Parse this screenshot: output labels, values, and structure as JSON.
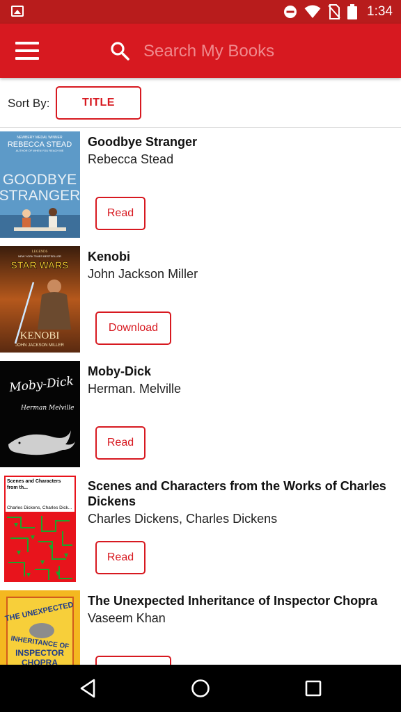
{
  "status_bar": {
    "time": "1:34",
    "icons": [
      "gallery-icon",
      "do-not-disturb-icon",
      "wifi-icon",
      "no-sim-icon",
      "battery-icon"
    ]
  },
  "app_bar": {
    "search_placeholder": "Search My Books",
    "icons": [
      "menu-icon",
      "search-icon"
    ]
  },
  "sort": {
    "label": "Sort By:",
    "value": "TITLE"
  },
  "books": [
    {
      "title": "Goodbye Stranger",
      "author": "Rebecca Stead",
      "action": "Read",
      "cover_text": [
        "NEWBERY MEDAL WINNER",
        "REBECCA STEAD",
        "AUTHOR OF WHEN YOU REACH ME",
        "GOODBYE",
        "STRANGER"
      ]
    },
    {
      "title": "Kenobi",
      "author": "John Jackson Miller",
      "action": "Download",
      "cover_text": [
        "LEGENDS",
        "NEW YORK TIMES BESTSELLER",
        "STAR WARS",
        "KENOBI",
        "JOHN JACKSON MILLER"
      ]
    },
    {
      "title": "Moby-Dick",
      "author": "Herman. Melville",
      "action": "Read",
      "cover_text": [
        "Moby-Dick",
        "Herman Melville"
      ]
    },
    {
      "title": "Scenes and Characters from the Works of Charles Dickens",
      "author": "Charles Dickens, Charles Dickens",
      "action": "Read",
      "cover_text": [
        "Scenes and Characters",
        "from th...",
        "Charles Dickens, Charles Dick..."
      ]
    },
    {
      "title": "The Unexpected Inheritance of Inspector Chopra",
      "author": "Vaseem Khan",
      "action": "",
      "cover_text": [
        "THE UNEXPECTED",
        "INHERITANCE OF",
        "INSPECTOR",
        "CHOPRA"
      ]
    }
  ],
  "colors": {
    "status_bar": "#b81c1c",
    "app_bar": "#d71920",
    "accent": "#d71920",
    "nav_bar": "#000000"
  },
  "nav": {
    "icons": [
      "back-icon",
      "home-icon",
      "recents-icon"
    ]
  }
}
